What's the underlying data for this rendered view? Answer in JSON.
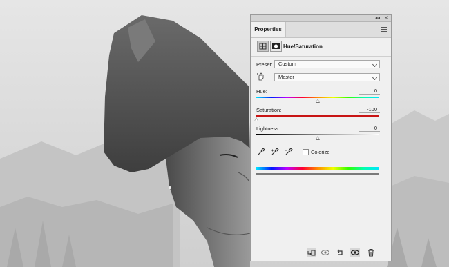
{
  "panel": {
    "tab_label": "Properties",
    "adjustment_title": "Hue/Saturation",
    "preset": {
      "label": "Preset:",
      "value": "Custom"
    },
    "channel": {
      "value": "Master"
    },
    "hue": {
      "label": "Hue:",
      "value": "0",
      "level": 0.5
    },
    "saturation": {
      "label": "Saturation:",
      "value": "-100",
      "level": 0.0
    },
    "lightness": {
      "label": "Lightness:",
      "value": "0",
      "level": 0.5
    },
    "colorize_label": "Colorize"
  },
  "icons": {
    "collapse": "double-chevron-icon",
    "close": "close-icon",
    "menu": "panel-menu-icon",
    "adjustment": "hue-saturation-icon",
    "mask": "layer-mask-icon",
    "hand": "targeted-adjustment-hand-icon",
    "eyedropper": "eyedropper-icon",
    "eyedropper_add": "eyedropper-add-icon",
    "eyedropper_sub": "eyedropper-subtract-icon",
    "clip": "clip-to-layer-icon",
    "view_previous": "view-previous-icon",
    "reset": "reset-icon",
    "visibility": "eye-icon",
    "delete": "trash-icon"
  },
  "colors": {
    "panel_bg": "#f0f0f0",
    "saturation_track": "#c81414"
  }
}
